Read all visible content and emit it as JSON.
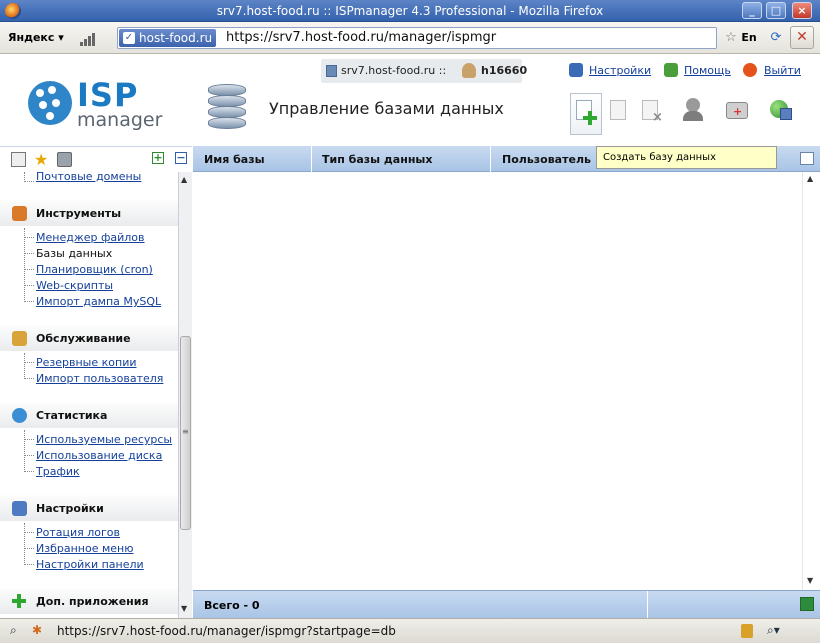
{
  "browser": {
    "window_title": "srv7.host-food.ru :: ISPmanager 4.3 Professional - Mozilla Firefox",
    "yandex_label": "Яндекс",
    "site_identity": "host-food.ru",
    "url": "https://srv7.host-food.ru/manager/ispmgr",
    "lang_badge": "En",
    "status_url": "https://srv7.host-food.ru/manager/ispmgr?startpage=db"
  },
  "header": {
    "server": "srv7.host-food.ru ::",
    "user": "h16660",
    "links": {
      "settings": "Настройки",
      "help": "Помощь",
      "logout": "Выйти"
    },
    "logo_isp": "ISP",
    "logo_manager": "manager",
    "page_title": "Управление базами данных",
    "tooltip": "Создать базу данных"
  },
  "sidebar": {
    "top_item": "Почтовые домены",
    "groups": [
      {
        "label": "Инструменты",
        "items": [
          "Менеджер файлов",
          "Базы данных",
          "Планировщик (cron)",
          "Web-скрипты",
          "Импорт дампа MySQL"
        ]
      },
      {
        "label": "Обслуживание",
        "items": [
          "Резервные копии",
          "Импорт пользователя"
        ]
      },
      {
        "label": "Статистика",
        "items": [
          "Используемые ресурсы",
          "Использование диска",
          "Трафик"
        ]
      },
      {
        "label": "Настройки",
        "items": [
          "Ротация логов",
          "Избранное меню",
          "Настройки панели"
        ]
      },
      {
        "label": "Доп. приложения",
        "items": []
      }
    ]
  },
  "table": {
    "columns": [
      "Имя базы",
      "Тип базы данных",
      "Пользователь"
    ],
    "footer_total": "Всего - 0"
  }
}
